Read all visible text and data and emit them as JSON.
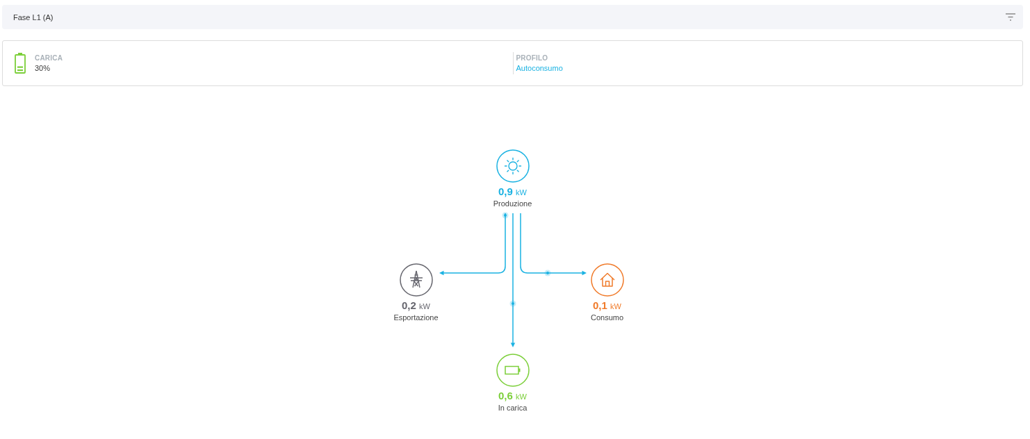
{
  "header": {
    "title": "Fase L1 (A)"
  },
  "summary": [
    {
      "kind": "charge",
      "label": "CARICA",
      "value": "30%"
    },
    {
      "kind": "profile",
      "label": "PROFILO",
      "value": "Autoconsumo"
    }
  ],
  "flow_diagram": {
    "nodes": [
      {
        "kind": "production",
        "value": "0,9",
        "unit": "kW",
        "label": "Produzione",
        "color": "#1ab2e2"
      },
      {
        "kind": "grid",
        "value": "0,2",
        "unit": "kW",
        "label": "Esportazione",
        "color": "#67676f"
      },
      {
        "kind": "home",
        "value": "0,1",
        "unit": "kW",
        "label": "Consumo",
        "color": "#f07b2b"
      },
      {
        "kind": "battery",
        "value": "0,6",
        "unit": "kW",
        "label": "In carica",
        "color": "#7ccf3a"
      }
    ]
  }
}
